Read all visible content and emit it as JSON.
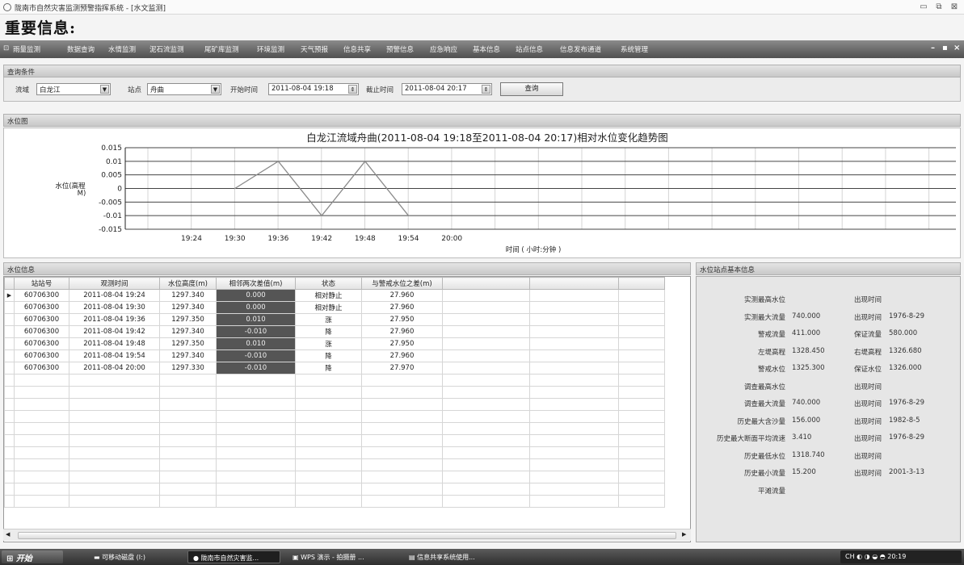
{
  "window": {
    "title": "陇南市自然灾害监测预警指挥系统 - [水文监测]"
  },
  "page_title": "重要信息:",
  "menu": [
    "雨量监测",
    "数据查询",
    "水情监测",
    "泥石流监测",
    "尾矿库监测",
    "环境监测",
    "天气预报",
    "信息共享",
    "预警信息",
    "应急响应",
    "基本信息",
    "站点信息",
    "信息发布通道",
    "系统管理"
  ],
  "query": {
    "header": "查询条件",
    "basin_label": "流域",
    "basin_value": "白龙江",
    "station_label": "站点",
    "station_value": "舟曲",
    "start_label": "开始时间",
    "start_value": "2011-08-04 19:18",
    "end_label": "截止时间",
    "end_value": "2011-08-04 20:17",
    "search_button": "查询"
  },
  "chart_panel": {
    "header": "水位图"
  },
  "chart_data": {
    "type": "line",
    "title": "白龙江流域舟曲(2011-08-04  19:18至2011-08-04  20:17)相对水位变化趋势图",
    "xlabel": "时间 ( 小时:分钟 )",
    "ylabel": "水位(高程 M)",
    "x_ticks": [
      "19:24",
      "19:30",
      "19:36",
      "19:42",
      "19:48",
      "19:54",
      "20:00"
    ],
    "y_ticks": [
      "0.015",
      "0.01",
      "0.005",
      "0",
      "-0.005",
      "-0.01",
      "-0.015"
    ],
    "ylim": [
      -0.015,
      0.015
    ],
    "grid": true,
    "series": [
      {
        "x": [
          "19:30",
          "19:36",
          "19:42",
          "19:48",
          "19:54"
        ],
        "values": [
          0.0,
          0.01,
          -0.01,
          0.01,
          -0.01
        ]
      }
    ]
  },
  "table": {
    "header": "水位信息",
    "columns": [
      "站站号",
      "观测时间",
      "水位高度(m)",
      "相邻两次差值(m)",
      "状态",
      "与警戒水位之差(m)"
    ],
    "rows": [
      [
        "60706300",
        "2011-08-04 19:24",
        "1297.340",
        "0.000",
        "相对静止",
        "27.960"
      ],
      [
        "60706300",
        "2011-08-04 19:30",
        "1297.340",
        "0.000",
        "相对静止",
        "27.960"
      ],
      [
        "60706300",
        "2011-08-04 19:36",
        "1297.350",
        "0.010",
        "涨",
        "27.950"
      ],
      [
        "60706300",
        "2011-08-04 19:42",
        "1297.340",
        "-0.010",
        "降",
        "27.960"
      ],
      [
        "60706300",
        "2011-08-04 19:48",
        "1297.350",
        "0.010",
        "涨",
        "27.950"
      ],
      [
        "60706300",
        "2011-08-04 19:54",
        "1297.340",
        "-0.010",
        "降",
        "27.960"
      ],
      [
        "60706300",
        "2011-08-04 20:00",
        "1297.330",
        "-0.010",
        "降",
        "27.970"
      ]
    ]
  },
  "station_info": {
    "header": "水位站点基本信息",
    "rows": [
      {
        "label": "实测最高水位",
        "value": "",
        "label2": "出现时间",
        "value2": ""
      },
      {
        "label": "实测最大流量",
        "value": "740.000",
        "label2": "出现时间",
        "value2": "1976-8-29"
      },
      {
        "label": "警戒流量",
        "value": "411.000",
        "label2": "保证流量",
        "value2": "580.000"
      },
      {
        "label": "左堤高程",
        "value": "1328.450",
        "label2": "右堤高程",
        "value2": "1326.680"
      },
      {
        "label": "警戒水位",
        "value": "1325.300",
        "label2": "保证水位",
        "value2": "1326.000"
      },
      {
        "label": "调查最高水位",
        "value": "",
        "label2": "出现时间",
        "value2": ""
      },
      {
        "label": "调查最大流量",
        "value": "740.000",
        "label2": "出现时间",
        "value2": "1976-8-29"
      },
      {
        "label": "历史最大含沙量",
        "value": "156.000",
        "label2": "出现时间",
        "value2": "1982-8-5"
      },
      {
        "label": "历史最大断面平均流速",
        "value": "3.410",
        "label2": "出现时间",
        "value2": "1976-8-29"
      },
      {
        "label": "历史最低水位",
        "value": "1318.740",
        "label2": "出现时间",
        "value2": ""
      },
      {
        "label": "历史最小流量",
        "value": "15.200",
        "label2": "出现时间",
        "value2": "2001-3-13"
      },
      {
        "label": "平滩流量",
        "value": "",
        "label2": "",
        "value2": ""
      }
    ]
  },
  "taskbar": {
    "start": "开始",
    "items": [
      "可移动磁盘 (I:)",
      "陇南市自然灾害监...",
      "WPS 演示 - 拍摄册 ...",
      "信息共享系统使用..."
    ],
    "tray_lang": "CH",
    "clock": "20:19"
  }
}
